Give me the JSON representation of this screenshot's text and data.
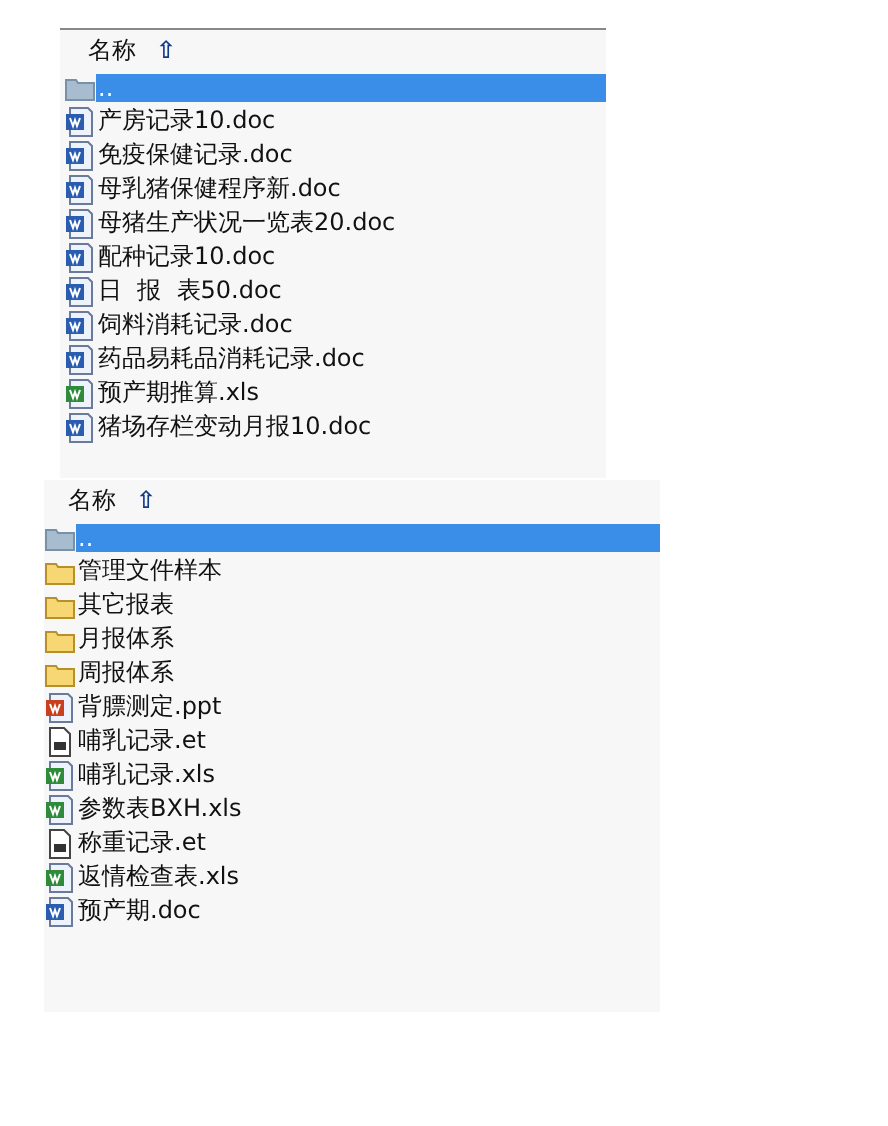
{
  "panels": [
    {
      "header": {
        "label": "名称",
        "sort_icon": "⇧"
      },
      "items": [
        {
          "kind": "parent",
          "name": "..",
          "selected": true
        },
        {
          "kind": "doc",
          "name": "产房记录10.doc",
          "selected": false
        },
        {
          "kind": "doc",
          "name": "免疫保健记录.doc",
          "selected": false
        },
        {
          "kind": "doc",
          "name": "母乳猪保健程序新.doc",
          "selected": false
        },
        {
          "kind": "doc",
          "name": "母猪生产状况一览表20.doc",
          "selected": false
        },
        {
          "kind": "doc",
          "name": "配种记录10.doc",
          "selected": false
        },
        {
          "kind": "doc",
          "name": "日  报  表50.doc",
          "selected": false
        },
        {
          "kind": "doc",
          "name": "饲料消耗记录.doc",
          "selected": false
        },
        {
          "kind": "doc",
          "name": "药品易耗品消耗记录.doc",
          "selected": false
        },
        {
          "kind": "xls",
          "name": "预产期推算.xls",
          "selected": false
        },
        {
          "kind": "doc",
          "name": "猪场存栏变动月报10.doc",
          "selected": false
        }
      ]
    },
    {
      "header": {
        "label": "名称",
        "sort_icon": "⇧"
      },
      "items": [
        {
          "kind": "parent",
          "name": "..",
          "selected": true
        },
        {
          "kind": "folder",
          "name": "管理文件样本",
          "selected": false
        },
        {
          "kind": "folder",
          "name": "其它报表",
          "selected": false
        },
        {
          "kind": "folder",
          "name": "月报体系",
          "selected": false
        },
        {
          "kind": "folder",
          "name": "周报体系",
          "selected": false
        },
        {
          "kind": "ppt",
          "name": "背膘测定.ppt",
          "selected": false
        },
        {
          "kind": "et",
          "name": "哺乳记录.et",
          "selected": false
        },
        {
          "kind": "xls",
          "name": "哺乳记录.xls",
          "selected": false
        },
        {
          "kind": "xls",
          "name": "参数表BXH.xls",
          "selected": false
        },
        {
          "kind": "et",
          "name": "称重记录.et",
          "selected": false
        },
        {
          "kind": "xls",
          "name": "返情检查表.xls",
          "selected": false
        },
        {
          "kind": "doc",
          "name": "预产期.doc",
          "selected": false
        }
      ]
    }
  ]
}
